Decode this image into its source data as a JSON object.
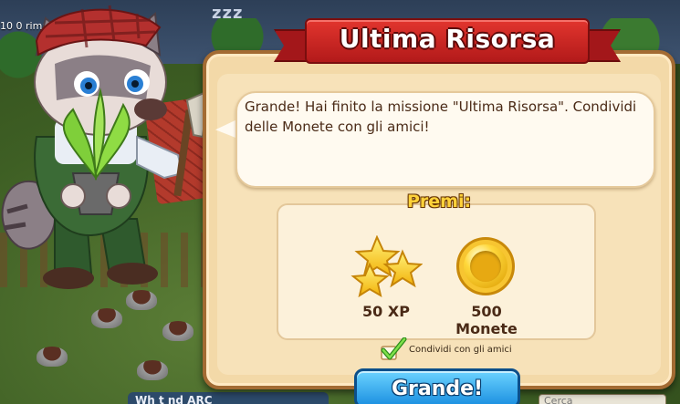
{
  "hud": {
    "timer_text": "10 0 rimas",
    "sleep_text": "zzz",
    "bottom_tab": "Wh  t       nd  ARC",
    "search_placeholder": "Cerca"
  },
  "dialog": {
    "title": "Ultima Risorsa",
    "message": "Grande! Hai finito la missione \"Ultima Risorsa\". Condividi delle Monete con gli amici!",
    "rewards_title": "Premi:",
    "rewards": [
      {
        "icon": "xp-stars-icon",
        "label": "50 XP"
      },
      {
        "icon": "gold-coin-icon",
        "label": "500 Monete"
      }
    ],
    "share_label": "Condividi con gli amici",
    "share_checked": true,
    "confirm_button": "Grande!"
  },
  "colors": {
    "ribbon": "#c8242a",
    "panel": "#f3d9a8",
    "button": "#2aa3ec",
    "rewards_title": "#ffd23a"
  }
}
